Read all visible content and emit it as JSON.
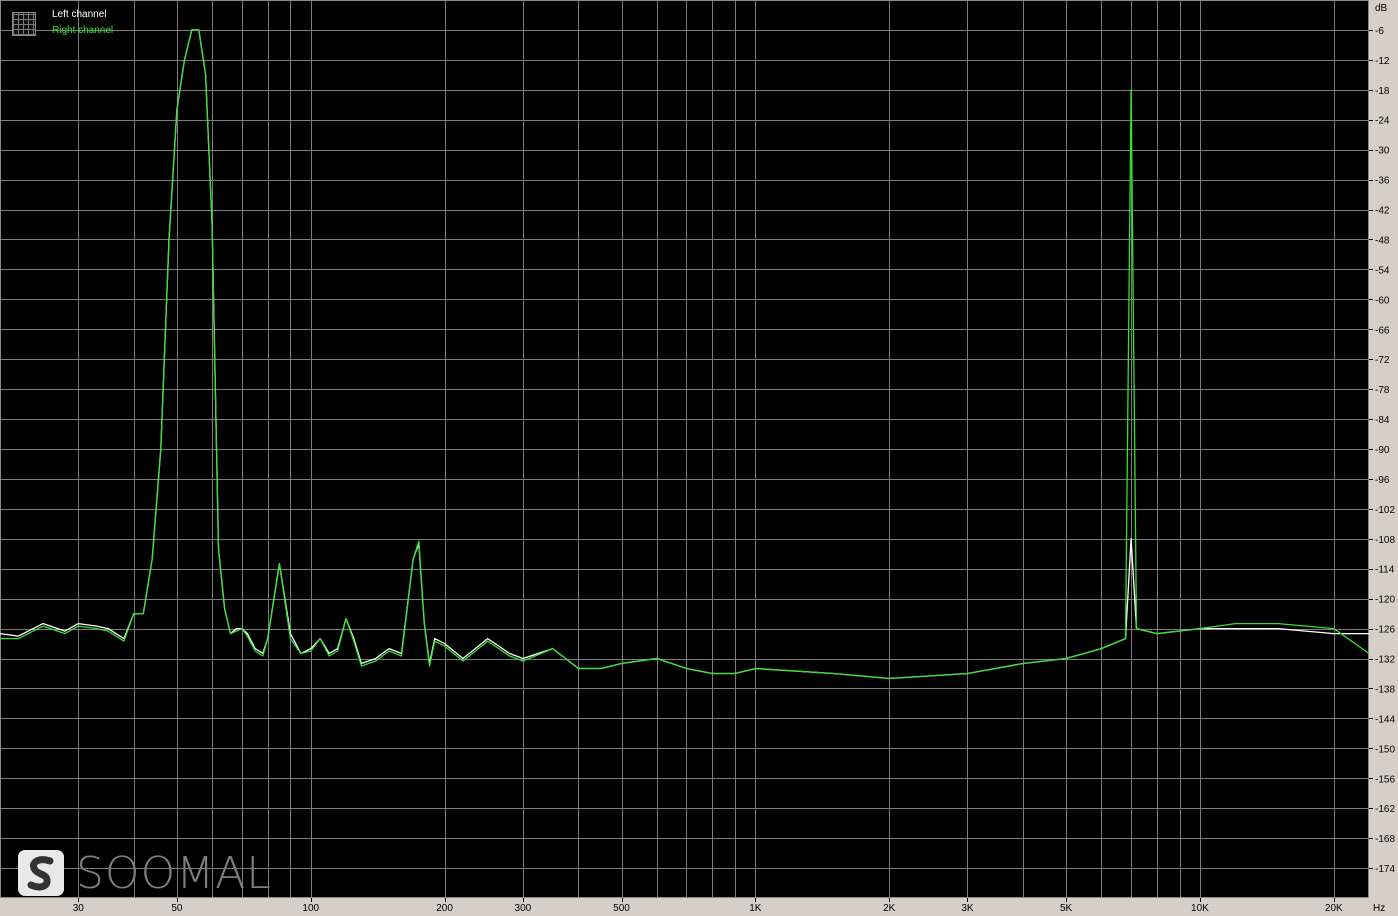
{
  "legend": {
    "left_label": "Left channel",
    "right_label": "Right channel"
  },
  "watermark": {
    "brand": "SOOMAL"
  },
  "colors": {
    "background": "#000000",
    "grid": "#7d7d7d",
    "axis_panel": "#d4d0c8",
    "left_channel": "#ffffff",
    "right_channel": "#36e02e"
  },
  "chart_data": {
    "type": "line",
    "title": "",
    "x_scale": "log",
    "xlim": [
      20,
      24000
    ],
    "ylim": [
      -180,
      0
    ],
    "y_unit": "dB",
    "x_unit": "Hz",
    "grid": true,
    "legend_position": "top-left",
    "x_ticks": [
      {
        "value": 30,
        "label": "30"
      },
      {
        "value": 50,
        "label": "50"
      },
      {
        "value": 100,
        "label": "100"
      },
      {
        "value": 200,
        "label": "200"
      },
      {
        "value": 300,
        "label": "300"
      },
      {
        "value": 500,
        "label": "500"
      },
      {
        "value": 1000,
        "label": "1K"
      },
      {
        "value": 2000,
        "label": "2K"
      },
      {
        "value": 3000,
        "label": "3K"
      },
      {
        "value": 5000,
        "label": "5K"
      },
      {
        "value": 10000,
        "label": "10K"
      },
      {
        "value": 20000,
        "label": "20K"
      }
    ],
    "x_grid_values": [
      20,
      30,
      40,
      50,
      60,
      70,
      80,
      90,
      100,
      200,
      300,
      400,
      500,
      600,
      700,
      800,
      900,
      1000,
      2000,
      3000,
      4000,
      5000,
      6000,
      7000,
      8000,
      9000,
      10000,
      20000
    ],
    "y_ticks": [
      -6,
      -12,
      -18,
      -24,
      -30,
      -36,
      -42,
      -48,
      -54,
      -60,
      -66,
      -72,
      -78,
      -84,
      -90,
      -96,
      -102,
      -108,
      -114,
      -120,
      -126,
      -132,
      -138,
      -144,
      -150,
      -156,
      -162,
      -168,
      -174
    ],
    "series": [
      {
        "name": "Left channel",
        "color": "#ffffff",
        "x": [
          20,
          22,
          25,
          28,
          30,
          33,
          35,
          38,
          40,
          42,
          44,
          46,
          48,
          50,
          52,
          54,
          56,
          58,
          60,
          62,
          64,
          66,
          68,
          70,
          72,
          75,
          78,
          80,
          85,
          90,
          95,
          100,
          105,
          110,
          115,
          120,
          125,
          130,
          140,
          150,
          160,
          170,
          175,
          180,
          185,
          190,
          200,
          220,
          250,
          280,
          300,
          350,
          400,
          450,
          500,
          600,
          700,
          800,
          900,
          1000,
          1500,
          2000,
          3000,
          4000,
          5000,
          6000,
          6800,
          7000,
          7200,
          8000,
          10000,
          12000,
          15000,
          20000,
          24000
        ],
        "y": [
          -127,
          -127.5,
          -125,
          -126.5,
          -125,
          -125.5,
          -126,
          -128,
          -123,
          -123,
          -112,
          -90,
          -48,
          -22,
          -12,
          -6,
          -6,
          -15,
          -45,
          -110,
          -122,
          -127,
          -126,
          -126,
          -127,
          -130,
          -131,
          -128,
          -113,
          -127,
          -131,
          -130,
          -128,
          -131,
          -130,
          -124,
          -128,
          -133,
          -132,
          -130,
          -131,
          -112,
          -109,
          -125,
          -133,
          -128,
          -129,
          -132,
          -128,
          -131,
          -132,
          -130,
          -134,
          -134,
          -133,
          -132,
          -134,
          -135,
          -135,
          -134,
          -135,
          -136,
          -135,
          -133,
          -132,
          -130,
          -128,
          -108,
          -126,
          -127,
          -126,
          -126,
          -126,
          -127,
          -127
        ]
      },
      {
        "name": "Right channel",
        "color": "#36e02e",
        "x": [
          20,
          22,
          25,
          28,
          30,
          33,
          35,
          38,
          40,
          42,
          44,
          46,
          48,
          50,
          52,
          54,
          56,
          58,
          60,
          62,
          64,
          66,
          68,
          70,
          72,
          75,
          78,
          80,
          85,
          90,
          95,
          100,
          105,
          110,
          115,
          120,
          125,
          130,
          140,
          150,
          160,
          170,
          175,
          180,
          185,
          190,
          200,
          220,
          250,
          280,
          300,
          350,
          400,
          450,
          500,
          600,
          700,
          800,
          900,
          1000,
          1500,
          2000,
          3000,
          4000,
          5000,
          6000,
          6800,
          7000,
          7200,
          8000,
          10000,
          12000,
          15000,
          20000,
          24000
        ],
        "y": [
          -128,
          -128,
          -125.5,
          -127,
          -125.5,
          -126,
          -126.5,
          -128.5,
          -123,
          -123,
          -112,
          -90,
          -48,
          -22,
          -12,
          -6,
          -6,
          -15,
          -45,
          -110,
          -122,
          -127,
          -126.5,
          -126,
          -127.5,
          -130.5,
          -131.5,
          -128,
          -113,
          -128,
          -131,
          -130.5,
          -128,
          -131.5,
          -130.5,
          -124,
          -128.5,
          -133.5,
          -132.5,
          -130.5,
          -131.5,
          -112,
          -108.5,
          -125,
          -133.5,
          -128.5,
          -129.5,
          -132.5,
          -128.5,
          -131.5,
          -132.5,
          -130,
          -134,
          -134,
          -133,
          -132,
          -134,
          -135,
          -135,
          -134,
          -135,
          -136,
          -135,
          -133,
          -132,
          -130,
          -128,
          -18,
          -126,
          -127,
          -126,
          -125,
          -125,
          -126,
          -131
        ]
      }
    ]
  }
}
